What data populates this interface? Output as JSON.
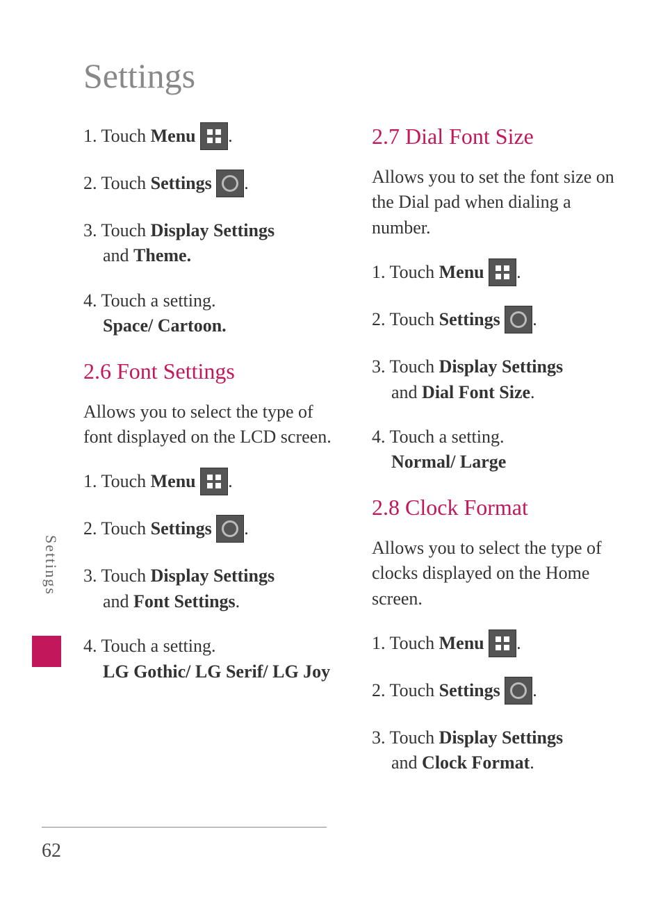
{
  "title": "Settings",
  "sidebarLabel": "Settings",
  "pageNumber": "62",
  "col1": {
    "steps_a": {
      "s1": {
        "num": "1.",
        "pre": " Touch ",
        "bold": "Menu"
      },
      "s2": {
        "num": "2.",
        "pre": " Touch ",
        "bold": "Settings"
      },
      "s3": {
        "num": "3.",
        "pre": " Touch ",
        "bold1": "Display Settings",
        "mid": " and ",
        "bold2": "Theme."
      },
      "s4": {
        "num": "4.",
        "text": " Touch a setting.",
        "bold": "Space/ Cartoon."
      }
    },
    "h1": "2.6 Font Settings",
    "p1": "Allows you to select the type of font displayed on the LCD screen.",
    "steps_b": {
      "s1": {
        "num": "1.",
        "pre": " Touch ",
        "bold": "Menu"
      },
      "s2": {
        "num": "2.",
        "pre": " Touch ",
        "bold": "Settings"
      },
      "s3": {
        "num": "3.",
        "pre": " Touch ",
        "bold1": "Display Settings",
        "mid": " and ",
        "bold2": "Font Settings"
      },
      "s4": {
        "num": "4.",
        "text": " Touch a setting.",
        "bold": "LG Gothic/ LG Serif/ LG Joy"
      }
    }
  },
  "col2": {
    "h1": "2.7 Dial Font Size",
    "p1": "Allows you to set the font size on the Dial pad when dialing a number.",
    "steps_a": {
      "s1": {
        "num": "1.",
        "pre": " Touch ",
        "bold": "Menu"
      },
      "s2": {
        "num": "2.",
        "pre": " Touch ",
        "bold": "Settings"
      },
      "s3": {
        "num": "3.",
        "pre": " Touch ",
        "bold1": "Display Settings",
        "mid": " and ",
        "bold2": "Dial Font Size"
      },
      "s4": {
        "num": "4.",
        "text": " Touch a setting.",
        "bold": "Normal/ Large"
      }
    },
    "h2": "2.8 Clock Format",
    "p2": "Allows you to select the type of clocks displayed on the Home screen.",
    "steps_b": {
      "s1": {
        "num": "1.",
        "pre": " Touch ",
        "bold": "Menu"
      },
      "s2": {
        "num": "2.",
        "pre": " Touch ",
        "bold": "Settings"
      },
      "s3": {
        "num": "3.",
        "pre": " Touch ",
        "bold1": "Display Settings",
        "mid": " and ",
        "bold2": "Clock Format"
      }
    }
  }
}
